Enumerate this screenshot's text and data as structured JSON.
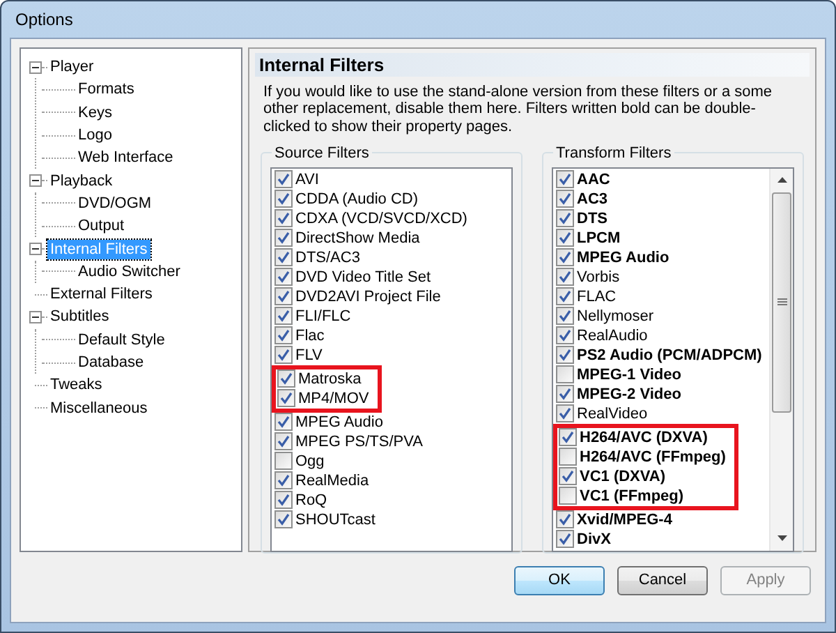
{
  "window": {
    "title": "Options"
  },
  "tree": [
    {
      "label": "Player",
      "expanded": true,
      "selected": false,
      "children": [
        {
          "label": "Formats",
          "selected": false
        },
        {
          "label": "Keys",
          "selected": false
        },
        {
          "label": "Logo",
          "selected": false
        },
        {
          "label": "Web Interface",
          "selected": false
        }
      ]
    },
    {
      "label": "Playback",
      "expanded": true,
      "selected": false,
      "children": [
        {
          "label": "DVD/OGM",
          "selected": false
        },
        {
          "label": "Output",
          "selected": false
        }
      ]
    },
    {
      "label": "Internal Filters",
      "expanded": true,
      "selected": true,
      "children": [
        {
          "label": "Audio Switcher",
          "selected": false
        }
      ]
    },
    {
      "label": "External Filters",
      "selected": false
    },
    {
      "label": "Subtitles",
      "expanded": true,
      "selected": false,
      "children": [
        {
          "label": "Default Style",
          "selected": false
        },
        {
          "label": "Database",
          "selected": false
        }
      ]
    },
    {
      "label": "Tweaks",
      "selected": false
    },
    {
      "label": "Miscellaneous",
      "selected": false
    }
  ],
  "page": {
    "title": "Internal Filters",
    "description": "If you would like to use the stand-alone version from these filters or a some other replacement, disable them here. Filters written bold can be double-clicked to show their property pages."
  },
  "source_filters": {
    "title": "Source Filters",
    "items": [
      {
        "label": "AVI",
        "checked": true,
        "bold": false,
        "highlighted": false
      },
      {
        "label": "CDDA (Audio CD)",
        "checked": true,
        "bold": false,
        "highlighted": false
      },
      {
        "label": "CDXA (VCD/SVCD/XCD)",
        "checked": true,
        "bold": false,
        "highlighted": false
      },
      {
        "label": "DirectShow Media",
        "checked": true,
        "bold": false,
        "highlighted": false
      },
      {
        "label": "DTS/AC3",
        "checked": true,
        "bold": false,
        "highlighted": false
      },
      {
        "label": "DVD Video Title Set",
        "checked": true,
        "bold": false,
        "highlighted": false
      },
      {
        "label": "DVD2AVI Project File",
        "checked": true,
        "bold": false,
        "highlighted": false
      },
      {
        "label": "FLI/FLC",
        "checked": true,
        "bold": false,
        "highlighted": false
      },
      {
        "label": "Flac",
        "checked": true,
        "bold": false,
        "highlighted": false
      },
      {
        "label": "FLV",
        "checked": true,
        "bold": false,
        "highlighted": false
      },
      {
        "label": "Matroska",
        "checked": true,
        "bold": false,
        "highlighted": true
      },
      {
        "label": "MP4/MOV",
        "checked": true,
        "bold": false,
        "highlighted": true
      },
      {
        "label": "MPEG Audio",
        "checked": true,
        "bold": false,
        "highlighted": false
      },
      {
        "label": "MPEG PS/TS/PVA",
        "checked": true,
        "bold": false,
        "highlighted": false
      },
      {
        "label": "Ogg",
        "checked": false,
        "bold": false,
        "highlighted": false
      },
      {
        "label": "RealMedia",
        "checked": true,
        "bold": false,
        "highlighted": false
      },
      {
        "label": "RoQ",
        "checked": true,
        "bold": false,
        "highlighted": false
      },
      {
        "label": "SHOUTcast",
        "checked": true,
        "bold": false,
        "highlighted": false
      }
    ]
  },
  "transform_filters": {
    "title": "Transform Filters",
    "items": [
      {
        "label": "AAC",
        "checked": true,
        "bold": true,
        "highlighted": false
      },
      {
        "label": "AC3",
        "checked": true,
        "bold": true,
        "highlighted": false
      },
      {
        "label": "DTS",
        "checked": true,
        "bold": true,
        "highlighted": false
      },
      {
        "label": "LPCM",
        "checked": true,
        "bold": true,
        "highlighted": false
      },
      {
        "label": "MPEG Audio",
        "checked": true,
        "bold": true,
        "highlighted": false
      },
      {
        "label": "Vorbis",
        "checked": true,
        "bold": false,
        "highlighted": false
      },
      {
        "label": "FLAC",
        "checked": true,
        "bold": false,
        "highlighted": false
      },
      {
        "label": "Nellymoser",
        "checked": true,
        "bold": false,
        "highlighted": false
      },
      {
        "label": "RealAudio",
        "checked": true,
        "bold": false,
        "highlighted": false
      },
      {
        "label": "PS2 Audio (PCM/ADPCM)",
        "checked": true,
        "bold": true,
        "highlighted": false
      },
      {
        "label": "MPEG-1 Video",
        "checked": false,
        "bold": true,
        "highlighted": false
      },
      {
        "label": "MPEG-2 Video",
        "checked": true,
        "bold": true,
        "highlighted": false
      },
      {
        "label": "RealVideo",
        "checked": true,
        "bold": false,
        "highlighted": false
      },
      {
        "label": "H264/AVC (DXVA)",
        "checked": true,
        "bold": true,
        "highlighted": true
      },
      {
        "label": "H264/AVC (FFmpeg)",
        "checked": false,
        "bold": true,
        "highlighted": true
      },
      {
        "label": "VC1 (DXVA)",
        "checked": true,
        "bold": true,
        "highlighted": true
      },
      {
        "label": "VC1 (FFmpeg)",
        "checked": false,
        "bold": true,
        "highlighted": true
      },
      {
        "label": "Xvid/MPEG-4",
        "checked": true,
        "bold": true,
        "highlighted": false
      },
      {
        "label": "DivX",
        "checked": true,
        "bold": true,
        "highlighted": false
      }
    ]
  },
  "buttons": [
    {
      "label": "OK",
      "default": true,
      "disabled": false
    },
    {
      "label": "Cancel",
      "default": false,
      "disabled": false
    },
    {
      "label": "Apply",
      "default": false,
      "disabled": true
    }
  ]
}
